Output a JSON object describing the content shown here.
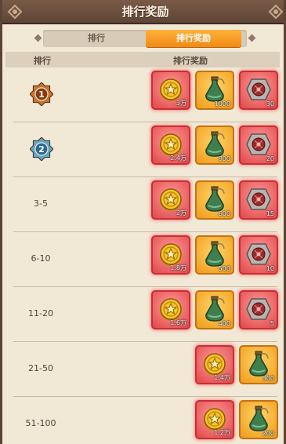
{
  "header": {
    "title": "排行奖励"
  },
  "tabs": [
    {
      "label": "排行",
      "active": false
    },
    {
      "label": "排行奖励",
      "active": true
    }
  ],
  "columns": {
    "rank": "排行",
    "reward": "排行奖励"
  },
  "colors": {
    "accent": "#ef8a16",
    "red_frame": "#e04848",
    "orange_frame": "#ef9b18"
  },
  "rows": [
    {
      "rank": "1",
      "rank_type": "badge-bronze",
      "rewards": [
        {
          "icon": "gold-coin-icon",
          "amount": "3万"
        },
        {
          "icon": "green-potion-icon",
          "amount": "1000"
        },
        {
          "icon": "red-gem-icon",
          "amount": "30"
        }
      ]
    },
    {
      "rank": "2",
      "rank_type": "badge-silver",
      "rewards": [
        {
          "icon": "gold-coin-icon",
          "amount": "2.4万"
        },
        {
          "icon": "green-potion-icon",
          "amount": "800"
        },
        {
          "icon": "red-gem-icon",
          "amount": "20"
        }
      ]
    },
    {
      "rank": "3-5",
      "rank_type": "text",
      "rewards": [
        {
          "icon": "gold-coin-icon",
          "amount": "2万"
        },
        {
          "icon": "green-potion-icon",
          "amount": "600"
        },
        {
          "icon": "red-gem-icon",
          "amount": "15"
        }
      ]
    },
    {
      "rank": "6-10",
      "rank_type": "text",
      "rewards": [
        {
          "icon": "gold-coin-icon",
          "amount": "1.8万"
        },
        {
          "icon": "green-potion-icon",
          "amount": "500"
        },
        {
          "icon": "red-gem-icon",
          "amount": "10"
        }
      ]
    },
    {
      "rank": "11-20",
      "rank_type": "text",
      "rewards": [
        {
          "icon": "gold-coin-icon",
          "amount": "1.6万"
        },
        {
          "icon": "green-potion-icon",
          "amount": "400"
        },
        {
          "icon": "red-gem-icon",
          "amount": "5"
        }
      ]
    },
    {
      "rank": "21-50",
      "rank_type": "text",
      "rewards": [
        {
          "icon": "gold-coin-icon",
          "amount": "1.4万"
        },
        {
          "icon": "green-potion-icon",
          "amount": "300"
        }
      ]
    },
    {
      "rank": "51-100",
      "rank_type": "text",
      "rewards": [
        {
          "icon": "gold-coin-icon",
          "amount": "1.2万"
        },
        {
          "icon": "green-potion-icon",
          "amount": "200"
        }
      ]
    }
  ]
}
